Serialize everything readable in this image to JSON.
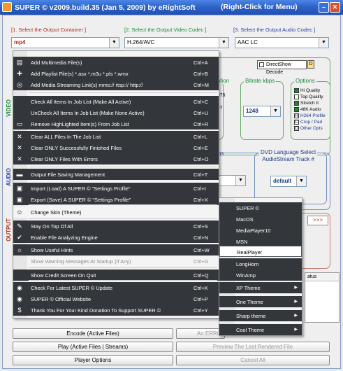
{
  "window": {
    "title": "SUPER © v2009.build.35 (Jan 5, 2009) by eRightSoft",
    "hint": "(Right-Click for Menu)",
    "min_glyph": "–",
    "close_glyph": "✕"
  },
  "headers": {
    "container": "[1.     Select the Output Container ]",
    "video_codec": "[2.  Select the Output Video Codec ]",
    "audio_codec": "[3.  Select the Output Audio Codec ]"
  },
  "selects": {
    "container": "mp4",
    "video_codec": "H.264/AVC",
    "audio_codec": "AAC LC",
    "arrow": "▼"
  },
  "side_labels": {
    "video": "VIDEO",
    "audio": "AUDIO",
    "output": "OUTPUT"
  },
  "video_panel": {
    "direct_show": "DirectShow Decode",
    "direct_show_badge": "D",
    "partial_header": "Motion",
    "partial_values": [
      "5",
      "23.976",
      "25",
      "29.97",
      "30",
      "50",
      "60"
    ],
    "bitrate_header": "Bitrate  kbps",
    "bitrate_value": "1248",
    "options_header": "Options",
    "options": [
      {
        "label": "Hi Quality",
        "checked": true
      },
      {
        "label": "Top Quality",
        "checked": false
      },
      {
        "label": "Stretch It",
        "checked": true
      },
      {
        "label": "48K Audio",
        "checked": true
      }
    ],
    "option_buttons": [
      {
        "badge": "H",
        "label": "H264 Profile"
      },
      {
        "badge": "C",
        "label": "Crop / Pad"
      },
      {
        "badge": "O",
        "label": "Other Opts"
      }
    ]
  },
  "audio_panel": {
    "partial_header": "ps",
    "dvd_header_line1": "DVD Language Select",
    "dvd_header_line2": "AudioStream  Track #",
    "dvd_value": "default"
  },
  "output_panel": {
    "arrows": ">>>",
    "status_header": "atus"
  },
  "context_menu": [
    {
      "icon": "add-file-icon",
      "glyph": "▤",
      "label": "Add Multimedia File(s)",
      "shortcut": "Ctrl+A",
      "style": "dark"
    },
    {
      "icon": "add-playlist-icon",
      "glyph": "✚",
      "label": "Add Playlist File(s)  *.asx  *.m3u  *.pls  *.wmx",
      "shortcut": "Ctrl+B",
      "style": "dark"
    },
    {
      "icon": "streaming-icon",
      "glyph": "◎",
      "label": "Add Media Streaming Link(s)   mms://  rtsp://  http://",
      "shortcut": "Ctrl+M",
      "style": "dark"
    },
    {
      "icon": "check-all-icon",
      "glyph": "",
      "label": "Check All Items In Job List (Make All Active)",
      "shortcut": "Ctrl+C",
      "style": "dark"
    },
    {
      "icon": "uncheck-all-icon",
      "glyph": "",
      "label": "UnCheck All Items In Job List (Make None Active)",
      "shortcut": "Ctrl+U",
      "style": "dark"
    },
    {
      "icon": "remove-icon",
      "glyph": "▭",
      "label": "Remove HighLighted Item(s) From Job List",
      "shortcut": "Ctrl+R",
      "style": "dark"
    },
    {
      "icon": "clear-all-icon",
      "glyph": "✕",
      "label": "Clear ALL Files In The Job List",
      "shortcut": "Ctrl+L",
      "style": "dark"
    },
    {
      "icon": "clear-success-icon",
      "glyph": "✕",
      "label": "Clear ONLY Successfully Finished Files",
      "shortcut": "Ctrl+E",
      "style": "dark"
    },
    {
      "icon": "clear-errors-icon",
      "glyph": "✕",
      "label": "Clear ONLY Files With Errors",
      "shortcut": "Ctrl+O",
      "style": "dark"
    },
    {
      "icon": "folder-icon",
      "glyph": "▬",
      "label": "Output File Saving Management",
      "shortcut": "Ctrl+T",
      "style": "dark"
    },
    {
      "icon": "import-icon",
      "glyph": "▣",
      "label": "Import (Load) A SUPER © \"Settings Profile\"",
      "shortcut": "Ctrl+I",
      "style": "dark"
    },
    {
      "icon": "export-icon",
      "glyph": "▣",
      "label": "Export (Save) A SUPER © \"Settings Profile\"",
      "shortcut": "Ctrl+X",
      "style": "dark"
    },
    {
      "icon": "skin-icon",
      "glyph": "☺",
      "label": "Change Skin (Theme)",
      "shortcut": "",
      "style": "light"
    },
    {
      "icon": "pin-icon",
      "glyph": "✎",
      "label": "Stay On Top Of All",
      "shortcut": "Ctrl+S",
      "style": "dark"
    },
    {
      "icon": "analyze-icon",
      "glyph": "✔",
      "label": "Enable File Analyzing Engine",
      "shortcut": "Ctrl+N",
      "style": "dark"
    },
    {
      "icon": "hint-icon",
      "glyph": "☼",
      "label": "Show Useful Hints",
      "shortcut": "Ctrl+W",
      "style": "dark"
    },
    {
      "icon": "warning-icon",
      "glyph": "",
      "label": "Show Warning Messages At Startup (If Any)",
      "shortcut": "Ctrl+G",
      "style": "dim"
    },
    {
      "icon": "credit-icon",
      "glyph": "",
      "label": "Show Credit Screen On Quit",
      "shortcut": "Ctrl+Q",
      "style": "dark"
    },
    {
      "icon": "update-icon",
      "glyph": "◉",
      "label": "Check For Latest SUPER © Update",
      "shortcut": "Ctrl+K",
      "style": "dark"
    },
    {
      "icon": "website-icon",
      "glyph": "◉",
      "label": "SUPER © Official Website",
      "shortcut": "Ctrl+P",
      "style": "dark"
    },
    {
      "icon": "donate-icon",
      "glyph": "$",
      "label": "Thank You For Your Kind Donation To Support SUPER ©",
      "shortcut": "Ctrl+Y",
      "style": "dark"
    }
  ],
  "skin_submenu": [
    {
      "label": "SUPER ©",
      "has_sub": false,
      "style": "dark"
    },
    {
      "label": "MacOS",
      "has_sub": false,
      "style": "dark"
    },
    {
      "label": "MediaPlayer10",
      "has_sub": false,
      "style": "dark"
    },
    {
      "label": "MSN",
      "has_sub": false,
      "style": "dark"
    },
    {
      "label": "RealPlayer",
      "has_sub": false,
      "style": "light"
    },
    {
      "label": "LongHorn",
      "has_sub": false,
      "style": "dark"
    },
    {
      "label": "WinAmp",
      "has_sub": false,
      "style": "dark"
    },
    {
      "label": "XP Theme",
      "has_sub": true,
      "style": "dark"
    },
    {
      "label": "One Theme",
      "has_sub": true,
      "style": "dark"
    },
    {
      "label": "Sharp theme",
      "has_sub": true,
      "style": "dark"
    },
    {
      "label": "Cool Theme",
      "has_sub": true,
      "style": "dark"
    }
  ],
  "submenu_arrow": "▶",
  "buttons": {
    "encode": "Encode (Active Files)",
    "error_partial": "An ERRO",
    "play": "Play (Active Files | Streams)",
    "preview": "Preview The Last Rendered File",
    "options": "Player Options",
    "cancel": "Cancel All"
  }
}
